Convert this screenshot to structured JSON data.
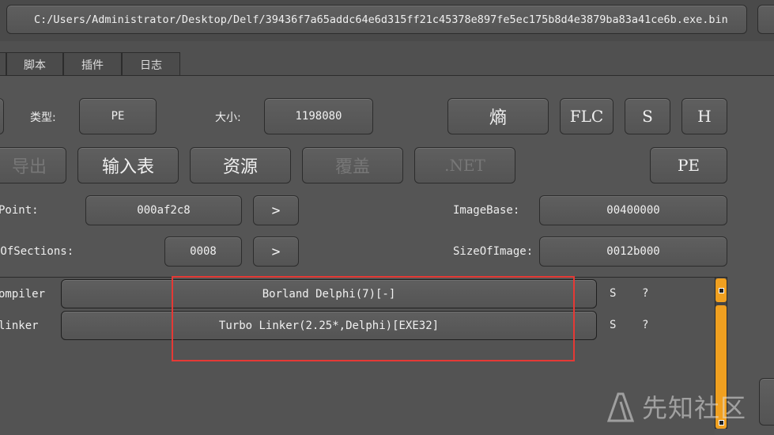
{
  "path": "C:/Users/Administrator/Desktop/Delf/39436f7a65addc64e6d315ff21c45378e897fe5ec175b8d4e3879ba83a41ce6b.exe.bin",
  "tabs": [
    "脚本",
    "插件",
    "日志"
  ],
  "info": {
    "type_label": "类型:",
    "type_value": "PE",
    "size_label": "大小:",
    "size_value": "1198080"
  },
  "tool_buttons": {
    "entropy": "熵",
    "flc": "FLC",
    "s": "S",
    "h": "H",
    "pe": "PE"
  },
  "section_buttons": {
    "export": "导出",
    "import": "输入表",
    "resource": "资源",
    "overlay": "覆盖",
    "net": ".NET"
  },
  "fields": {
    "entrypoint_label": "Point:",
    "entrypoint_value": "000af2c8",
    "imagebase_label": "ImageBase:",
    "imagebase_value": "00400000",
    "sections_label": "rOfSections:",
    "sections_value": "0008",
    "sizeofimage_label": "SizeOfImage:",
    "sizeofimage_value": "0012b000",
    "arrow": ">"
  },
  "detections": [
    {
      "type": "ompiler",
      "value": "Borland Delphi(7)[-]",
      "s": "S",
      "q": "?"
    },
    {
      "type": "linker",
      "value": "Turbo Linker(2.25*,Delphi)[EXE32]",
      "s": "S",
      "q": "?"
    }
  ],
  "watermark": "先知社区",
  "colors": {
    "background": "#555555",
    "highlight_box": "#e53935",
    "scrollbar": "#f0a020"
  }
}
